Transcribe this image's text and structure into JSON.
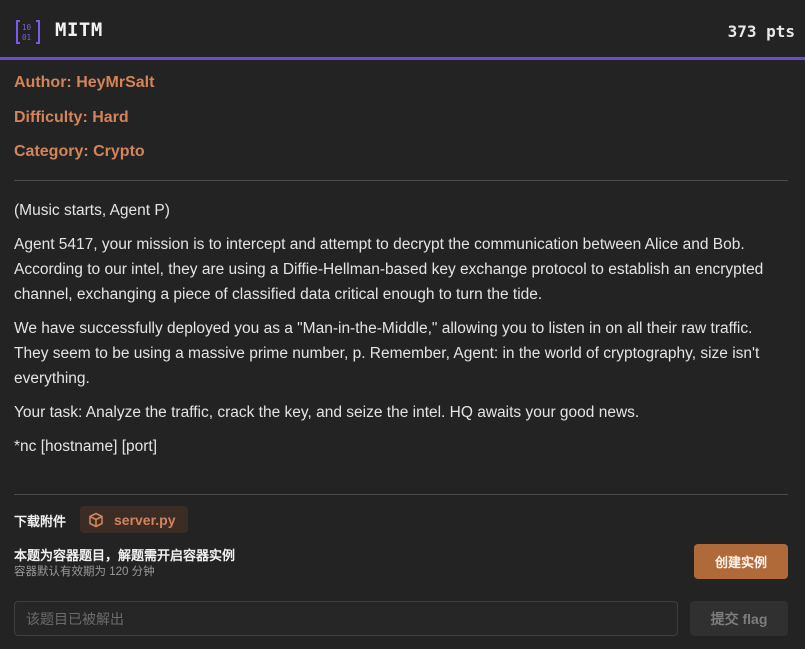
{
  "challenge": {
    "title": "MITM",
    "points": "373 pts",
    "icon": "binary-file-icon",
    "accent_color": "#6d4ad6"
  },
  "meta": {
    "author": "Author: HeyMrSalt",
    "difficulty": "Difficulty: Hard",
    "category": "Category: Crypto",
    "color": "#d3845a"
  },
  "description": {
    "paragraphs": [
      "(Music starts, Agent P)",
      "Agent 5417, your mission is to intercept and attempt to decrypt the communication between Alice and Bob. According to our intel, they are using a Diffie-Hellman-based key exchange protocol to establish an encrypted channel, exchanging a piece of classified data critical enough to turn the tide.",
      "We have successfully deployed you as a \"Man-in-the-Middle,\" allowing you to listen in on all their raw traffic. They seem to be using a massive prime number, p. Remember, Agent: in the world of cryptography, size isn't everything.",
      "Your task: Analyze the traffic, crack the key, and seize the intel. HQ awaits your good news.",
      "*nc [hostname] [port]"
    ]
  },
  "attachments": {
    "label": "下载附件",
    "file_name": "server.py",
    "file_icon": "package-icon"
  },
  "container": {
    "title": "本题为容器题目，解题需开启容器实例",
    "subtitle": "容器默认有效期为 120 分钟",
    "create_label": "创建实例",
    "button_color": "#b06a3a"
  },
  "flag": {
    "placeholder": "该题目已被解出",
    "value": "",
    "submit_label": "提交 flag"
  }
}
